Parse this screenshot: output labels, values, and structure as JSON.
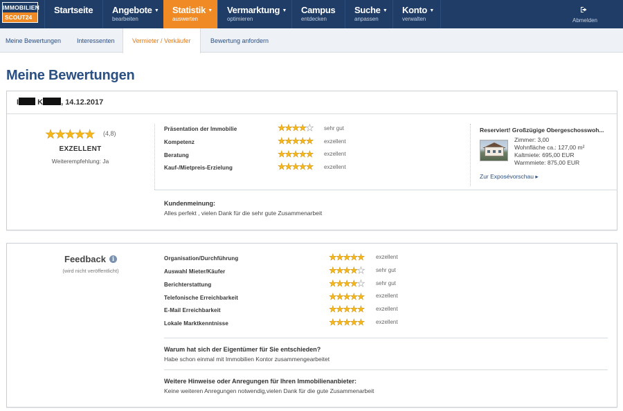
{
  "logo": {
    "line1": "IMMOBILIEN",
    "line2": "SCOUT24"
  },
  "nav": [
    {
      "label": "Startseite",
      "sub": "",
      "caret": false,
      "active": false
    },
    {
      "label": "Angebote",
      "sub": "bearbeiten",
      "caret": true,
      "active": false
    },
    {
      "label": "Statistik",
      "sub": "auswerten",
      "caret": true,
      "active": true
    },
    {
      "label": "Vermarktung",
      "sub": "optimieren",
      "caret": true,
      "active": false
    },
    {
      "label": "Campus",
      "sub": "entdecken",
      "caret": false,
      "active": false
    },
    {
      "label": "Suche",
      "sub": "anpassen",
      "caret": true,
      "active": false
    },
    {
      "label": "Konto",
      "sub": "verwalten",
      "caret": true,
      "active": false
    }
  ],
  "logout": {
    "label": "Abmelden",
    "icon": "logout-icon"
  },
  "subtabs": [
    {
      "label": "Meine Bewertungen",
      "active": false
    },
    {
      "label": "Interessenten",
      "active": false
    },
    {
      "label": "Vermieter / Verkäufer",
      "active": true
    },
    {
      "label": "Bewertung anfordern",
      "active": false
    }
  ],
  "page_title": "Meine Bewertungen",
  "review": {
    "reviewer_initial_1": "I",
    "reviewer_initial_2": "K",
    "date": ", 14.12.2017",
    "overall_stars": 5,
    "overall_score": "(4,8)",
    "overall_label": "EXZELLENT",
    "recommendation": "Weiterempfehlung: Ja",
    "criteria": [
      {
        "label": "Präsentation der Immobilie",
        "stars": 4,
        "value": "sehr gut"
      },
      {
        "label": "Kompetenz",
        "stars": 5,
        "value": "exzellent"
      },
      {
        "label": "Beratung",
        "stars": 5,
        "value": "exzellent"
      },
      {
        "label": "Kauf-/Mietpreis-Erzielung",
        "stars": 5,
        "value": "exzellent"
      }
    ],
    "listing": {
      "title": "Reserviert! Großzügige Obergeschosswoh...",
      "details": [
        "Zimmer: 3,00",
        "Wohnfläche ca.: 127,00 m²",
        "Kaltmiete: 695,00 EUR",
        "Warmmiete: 875,00 EUR"
      ],
      "link": "Zur Exposévorschau ▸"
    },
    "opinion_label": "Kundenmeinung:",
    "opinion_text": "Alles perfekt , vielen Dank für die sehr gute Zusammenarbeit"
  },
  "feedback": {
    "title": "Feedback",
    "info_icon": "i",
    "note": "(wird nicht veröffentlicht)",
    "criteria": [
      {
        "label": "Organisation/Durchführung",
        "stars": 5,
        "value": "exzellent"
      },
      {
        "label": "Auswahl Mieter/Käufer",
        "stars": 4,
        "value": "sehr gut"
      },
      {
        "label": "Berichterstattung",
        "stars": 4,
        "value": "sehr gut"
      },
      {
        "label": "Telefonische Erreichbarkeit",
        "stars": 5,
        "value": "exzellent"
      },
      {
        "label": "E-Mail Erreichbarkeit",
        "stars": 5,
        "value": "exzellent"
      },
      {
        "label": "Lokale Marktkenntnisse",
        "stars": 5,
        "value": "exzellent"
      }
    ],
    "q1_label": "Warum hat sich der Eigentümer für Sie entschieden?",
    "q1_text": "Habe schon einmal mit Immobilien Kontor zusammengearbeitet",
    "q2_label": "Weitere Hinweise oder Anregungen für Ihren Immobilienanbieter:",
    "q2_text": "Keine weiteren Anregungen notwendig,vielen Dank für die gute Zusammenarbeit"
  },
  "colors": {
    "nav_bg": "#1f3d66",
    "accent": "#f08a24",
    "link": "#2a4f83",
    "star": "#f5b71a"
  }
}
